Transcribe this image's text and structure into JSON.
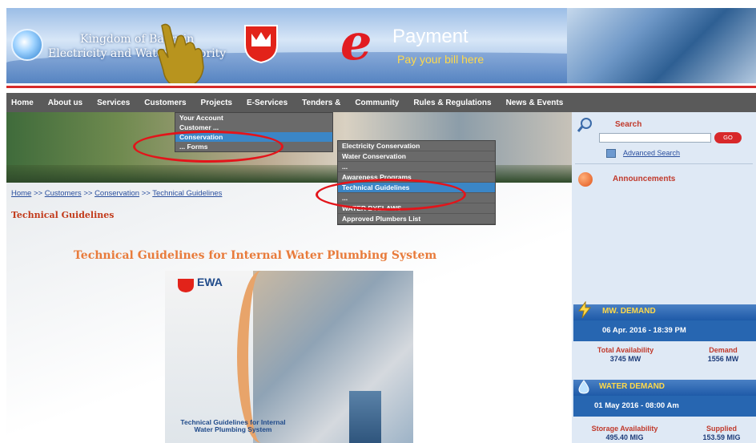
{
  "header": {
    "authority_name_line1": "Kingdom of Bahrain",
    "authority_name_line2": "Electricity and Water Authority",
    "epay_letter": "e",
    "epay_title": "Payment",
    "epay_subtitle": "Pay your bill here"
  },
  "nav": {
    "items": [
      "Home",
      "About us",
      "Services",
      "Customers",
      "Projects",
      "E-Services",
      "Tenders &",
      "Community",
      "Rules & Regulations",
      "News & Events"
    ]
  },
  "dropdown_customers": {
    "items": [
      "Your Account",
      "Customer ...",
      "Conservation",
      "... Forms"
    ],
    "active_index": 2
  },
  "dropdown_conservation": {
    "items": [
      "Electricity Conservation",
      "Water Conservation",
      "...",
      "Awareness Programs",
      "Technical Guidelines",
      "...",
      "WATER BYELAWS",
      "Approved Plumbers List"
    ],
    "active_index": 4
  },
  "breadcrumb": {
    "home": "Home",
    "sep": ">>",
    "customers": "Customers",
    "conservation": "Conservation",
    "current": "Technical Guidelines"
  },
  "page": {
    "title": "Technical Guidelines",
    "doc_heading": "Technical Guidelines for Internal Water Plumbing System"
  },
  "cover": {
    "logo_text": "EWA",
    "title": "Technical Guidelines for Internal Water Plumbing System"
  },
  "sidebar": {
    "search_label": "Search",
    "go_label": "GO",
    "advanced_search": "Advanced Search",
    "announcements": "Announcements",
    "mw_title": "MW. DEMAND",
    "mw_date": "06 Apr. 2016 - 18:39 PM",
    "total_availability_label": "Total Availability",
    "total_availability_value": "3745 MW",
    "demand_label": "Demand",
    "demand_value": "1556 MW",
    "water_title": "WATER DEMAND",
    "water_date": "01 May 2016 - 08:00 Am",
    "storage_label": "Storage Availability",
    "storage_value": "495.40 MIG",
    "supplied_label": "Supplied",
    "supplied_value": "153.59 MIG"
  },
  "colors": {
    "nav_bg": "#5a5a5a",
    "highlight_blue": "#3b86c6",
    "annotation_red": "#e3141a",
    "title_red": "#c23a1a",
    "heading_orange": "#e87b3b"
  }
}
